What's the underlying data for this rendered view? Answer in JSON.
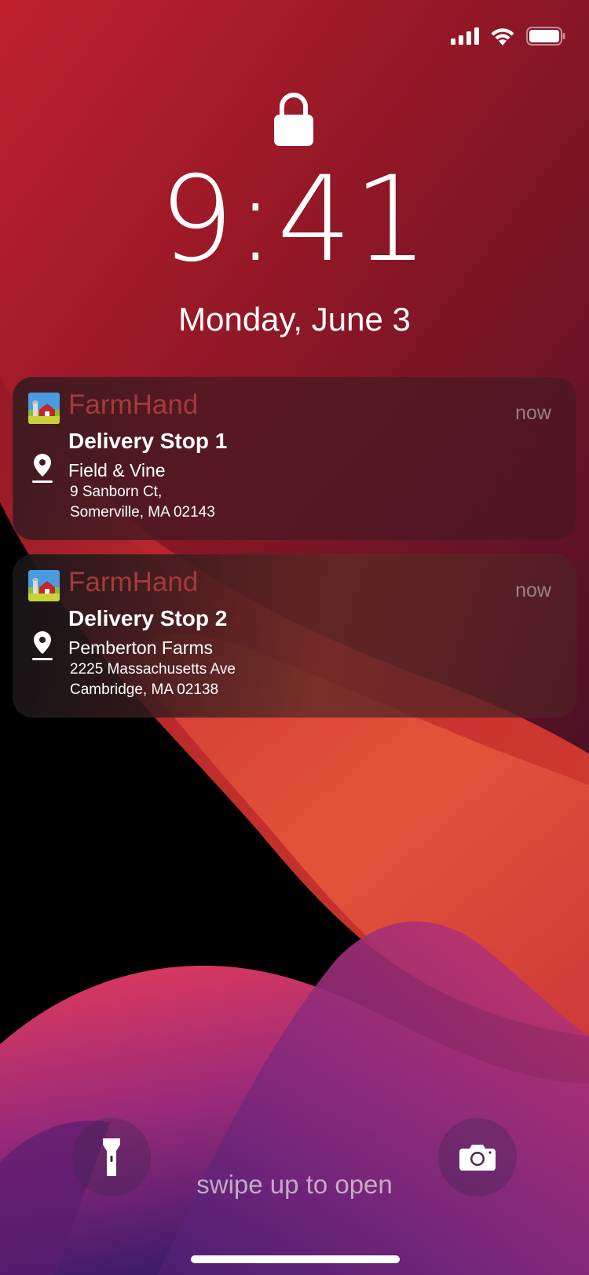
{
  "status_bar": {
    "icons": [
      "signal-icon",
      "wifi-icon",
      "battery-icon"
    ]
  },
  "lock_screen": {
    "time": "9:41",
    "date": "Monday, June 3",
    "lock_icon": "lock-icon"
  },
  "notifications": [
    {
      "app_name": "FarmHand",
      "time": "now",
      "title": "Delivery Stop 1",
      "stop_name": "Field & Vine",
      "address_line1": "9 Sanborn Ct,",
      "address_line2": "Somerville, MA 02143"
    },
    {
      "app_name": "FarmHand",
      "time": "now",
      "title": "Delivery Stop 2",
      "stop_name": "Pemberton Farms",
      "address_line1": "2225 Massachusetts Ave",
      "address_line2": "Cambridge, MA 02138"
    }
  ],
  "bottom": {
    "swipe_text": "swipe up to open",
    "left_button_icon": "flashlight-icon",
    "right_button_icon": "camera-icon"
  },
  "colors": {
    "app_name": "#a33a3f",
    "timestamp": "#9a7f85",
    "wallpaper_red": "#b0232e",
    "wallpaper_orange": "#e04a33",
    "wallpaper_purple": "#5a1f7a"
  }
}
